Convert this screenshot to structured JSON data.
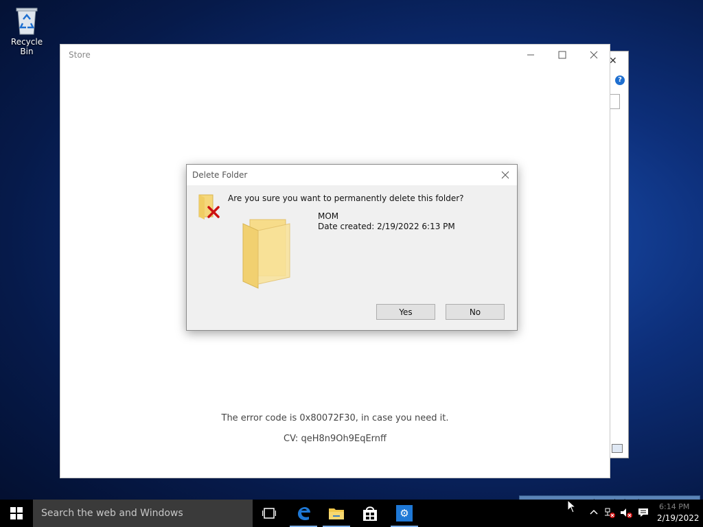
{
  "desktop": {
    "recycle_bin_label": "Recycle Bin"
  },
  "store_window": {
    "title": "Store",
    "error_text": "The error code is 0x80072F30, in case you need it.",
    "cv_text": "CV: qeH8n9Oh9EqErnff"
  },
  "dialog": {
    "title": "Delete Folder",
    "question": "Are you sure you want to permanently delete this folder?",
    "item_name": "MOM",
    "item_date": "Date created: 2/19/2022 6:13 PM",
    "yes_label": "Yes",
    "no_label": "No"
  },
  "tooltip": {
    "text": "Open Network and Sharing Center"
  },
  "taskbar": {
    "search_placeholder": "Search the web and Windows",
    "apps": [
      "task-view",
      "edge",
      "file-explorer",
      "store",
      "settings"
    ],
    "clock_time": "6:14 PM",
    "clock_date": "2/19/2022"
  },
  "colors": {
    "accent": "#1e6fd0",
    "tooltip_bg": "#5a83b6",
    "folder": "#f5d77a",
    "error_x": "#cc1111"
  }
}
